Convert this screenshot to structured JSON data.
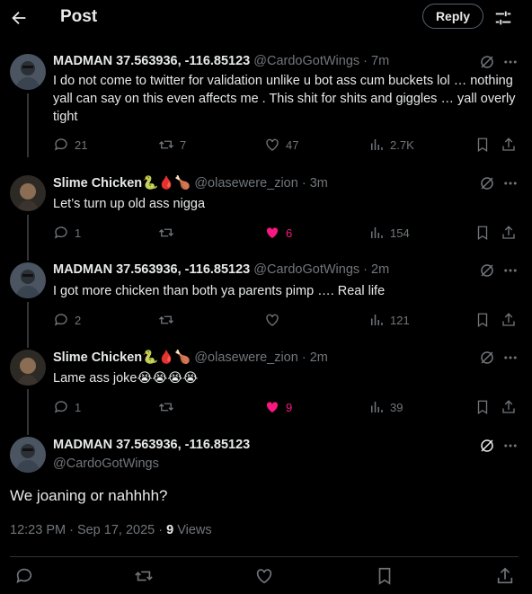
{
  "header": {
    "title": "Post",
    "reply_label": "Reply"
  },
  "replies": [
    {
      "name": "MADMAN 37.563936, -116.85123",
      "handle": "@CardoGotWings · 7m",
      "text": "I do not come to twitter for validation unlike u bot ass cum buckets lol … nothing yall can say on this even affects me . This shit for shits and giggles … yall overly tight",
      "replies": "21",
      "reposts": "7",
      "likes": "47",
      "views": "2.7K",
      "liked": false
    },
    {
      "name": "Slime Chicken🐍🩸🍗",
      "handle": "@olasewere_zion · 3m",
      "text": "Let’s turn up old ass nigga",
      "replies": "1",
      "reposts": "",
      "likes": "6",
      "views": "154",
      "liked": true
    },
    {
      "name": "MADMAN 37.563936, -116.85123",
      "handle": "@CardoGotWings · 2m",
      "text": "I got more chicken than both ya parents pimp …. Real life",
      "replies": "2",
      "reposts": "",
      "likes": "",
      "views": "121",
      "liked": false
    },
    {
      "name": "Slime Chicken🐍🩸🍗",
      "handle": "@olasewere_zion · 2m",
      "text": "Lame ass joke😭😭😭😭",
      "replies": "1",
      "reposts": "",
      "likes": "9",
      "views": "39",
      "liked": true
    }
  ],
  "main_post": {
    "name": "MADMAN 37.563936, -116.85123",
    "handle": "@CardoGotWings",
    "text": "We joaning or nahhhh?",
    "timestamp": "12:23 PM · Sep 17, 2025 · ",
    "views_count": "9",
    "views_label": " Views"
  },
  "icons": {
    "back": "arrow-left-icon",
    "filter": "sliders-icon",
    "grok": "grok-icon",
    "more": "more-dots-icon",
    "reply": "comment-icon",
    "repost": "repost-icon",
    "like": "heart-icon",
    "views": "views-bars-icon",
    "bookmark": "bookmark-icon",
    "share": "share-icon"
  },
  "colors": {
    "background": "#000000",
    "text": "#e7e9ea",
    "muted": "#71767b",
    "like": "#f91880"
  }
}
